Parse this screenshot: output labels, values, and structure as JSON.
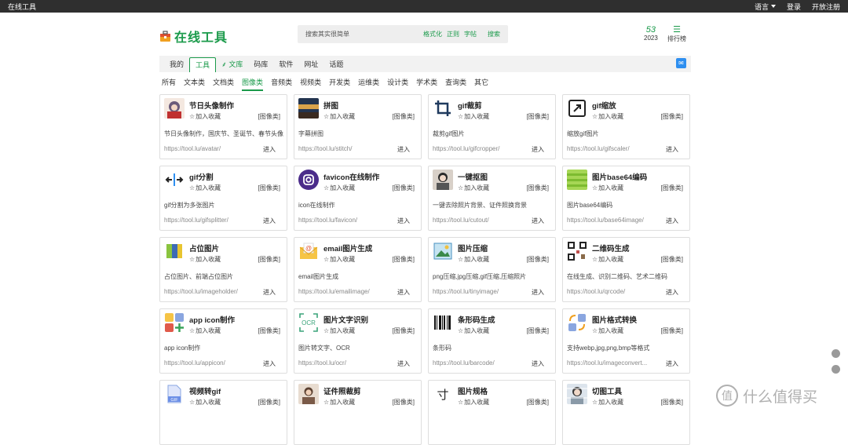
{
  "topbar": {
    "site_title": "在线工具",
    "language": "语言",
    "login": "登录",
    "open_register": "开放注册"
  },
  "header": {
    "logo_text": "在线工具",
    "search_placeholder": "搜索其实很简单",
    "chips": [
      "格式化",
      "正则",
      "字帖"
    ],
    "search_button": "搜索",
    "stat_number": "53",
    "stat_year": "2023",
    "rank_label": "排行榜"
  },
  "nav": {
    "items": [
      {
        "label": "我的"
      },
      {
        "label": "工具"
      },
      {
        "label": "文库"
      },
      {
        "label": "码库"
      },
      {
        "label": "软件"
      },
      {
        "label": "网址"
      },
      {
        "label": "话题"
      }
    ]
  },
  "subnav": {
    "items": [
      "所有",
      "文本类",
      "文档类",
      "图像类",
      "音频类",
      "视频类",
      "开发类",
      "运维类",
      "设计类",
      "学术类",
      "查询类",
      "其它"
    ]
  },
  "colors": {
    "accent": "#1a9a4a",
    "topbar": "#2f2f2f",
    "nav_bg": "#f2f2f2"
  },
  "common": {
    "fav_label": "加入收藏",
    "category": "[图像类]",
    "enter": "进入"
  },
  "tools": [
    {
      "title": "节日头像制作",
      "desc": "节日头像制作，国庆节、圣诞节、春节头像",
      "url": "https://tool.lu/avatar/",
      "icon": "avatar-icon"
    },
    {
      "title": "拼图",
      "desc": "字幕拼图",
      "url": "https://tool.lu/stitch/",
      "icon": "stitch-icon"
    },
    {
      "title": "gif裁剪",
      "desc": "裁剪gif图片",
      "url": "https://tool.lu/gifcropper/",
      "icon": "crop-icon"
    },
    {
      "title": "gif缩放",
      "desc": "缩放gif图片",
      "url": "https://tool.lu/gifscaler/",
      "icon": "scale-icon"
    },
    {
      "title": "gif分割",
      "desc": "gif分割为多张图片",
      "url": "https://tool.lu/gifsplitter/",
      "icon": "split-icon"
    },
    {
      "title": "favicon在线制作",
      "desc": "icon在线制作",
      "url": "https://tool.lu/favicon/",
      "icon": "favicon-icon"
    },
    {
      "title": "一键抠图",
      "desc": "一键去除照片背景、证件照换背景",
      "url": "https://tool.lu/cutout/",
      "icon": "cutout-icon"
    },
    {
      "title": "图片base64编码",
      "desc": "图片base64编码",
      "url": "https://tool.lu/base64image/",
      "icon": "base64-icon"
    },
    {
      "title": "占位图片",
      "desc": "占位图片、前端占位图片",
      "url": "https://tool.lu/imageholder/",
      "icon": "placeholder-icon"
    },
    {
      "title": "email图片生成",
      "desc": "email图片生成",
      "url": "https://tool.lu/emailimage/",
      "icon": "email-icon"
    },
    {
      "title": "图片压缩",
      "desc": "png压缩,jpg压缩,gif压缩,压缩照片",
      "url": "https://tool.lu/tinyimage/",
      "icon": "compress-icon"
    },
    {
      "title": "二维码生成",
      "desc": "在线生成、识别二维码、艺术二维码",
      "url": "https://tool.lu/qrcode/",
      "icon": "qrcode-icon"
    },
    {
      "title": "app icon制作",
      "desc": "app icon制作",
      "url": "https://tool.lu/appicon/",
      "icon": "appicon-icon"
    },
    {
      "title": "图片文字识别",
      "desc": "图片转文字、OCR",
      "url": "https://tool.lu/ocr/",
      "icon": "ocr-icon"
    },
    {
      "title": "条形码生成",
      "desc": "条形码",
      "url": "https://tool.lu/barcode/",
      "icon": "barcode-icon"
    },
    {
      "title": "图片格式转换",
      "desc": "支持webp,jpg,png,bmp等格式",
      "url": "https://tool.lu/imageconvert...",
      "icon": "convert-icon"
    },
    {
      "title": "视频转gif",
      "desc": "",
      "url": "",
      "icon": "video-gif-icon"
    },
    {
      "title": "证件照裁剪",
      "desc": "",
      "url": "",
      "icon": "idphoto-icon"
    },
    {
      "title": "图片规格",
      "desc": "",
      "url": "",
      "icon": "spec-icon"
    },
    {
      "title": "切图工具",
      "desc": "",
      "url": "",
      "icon": "slice-icon"
    }
  ],
  "watermark": {
    "text": "什么值得买",
    "glyph": "值"
  }
}
